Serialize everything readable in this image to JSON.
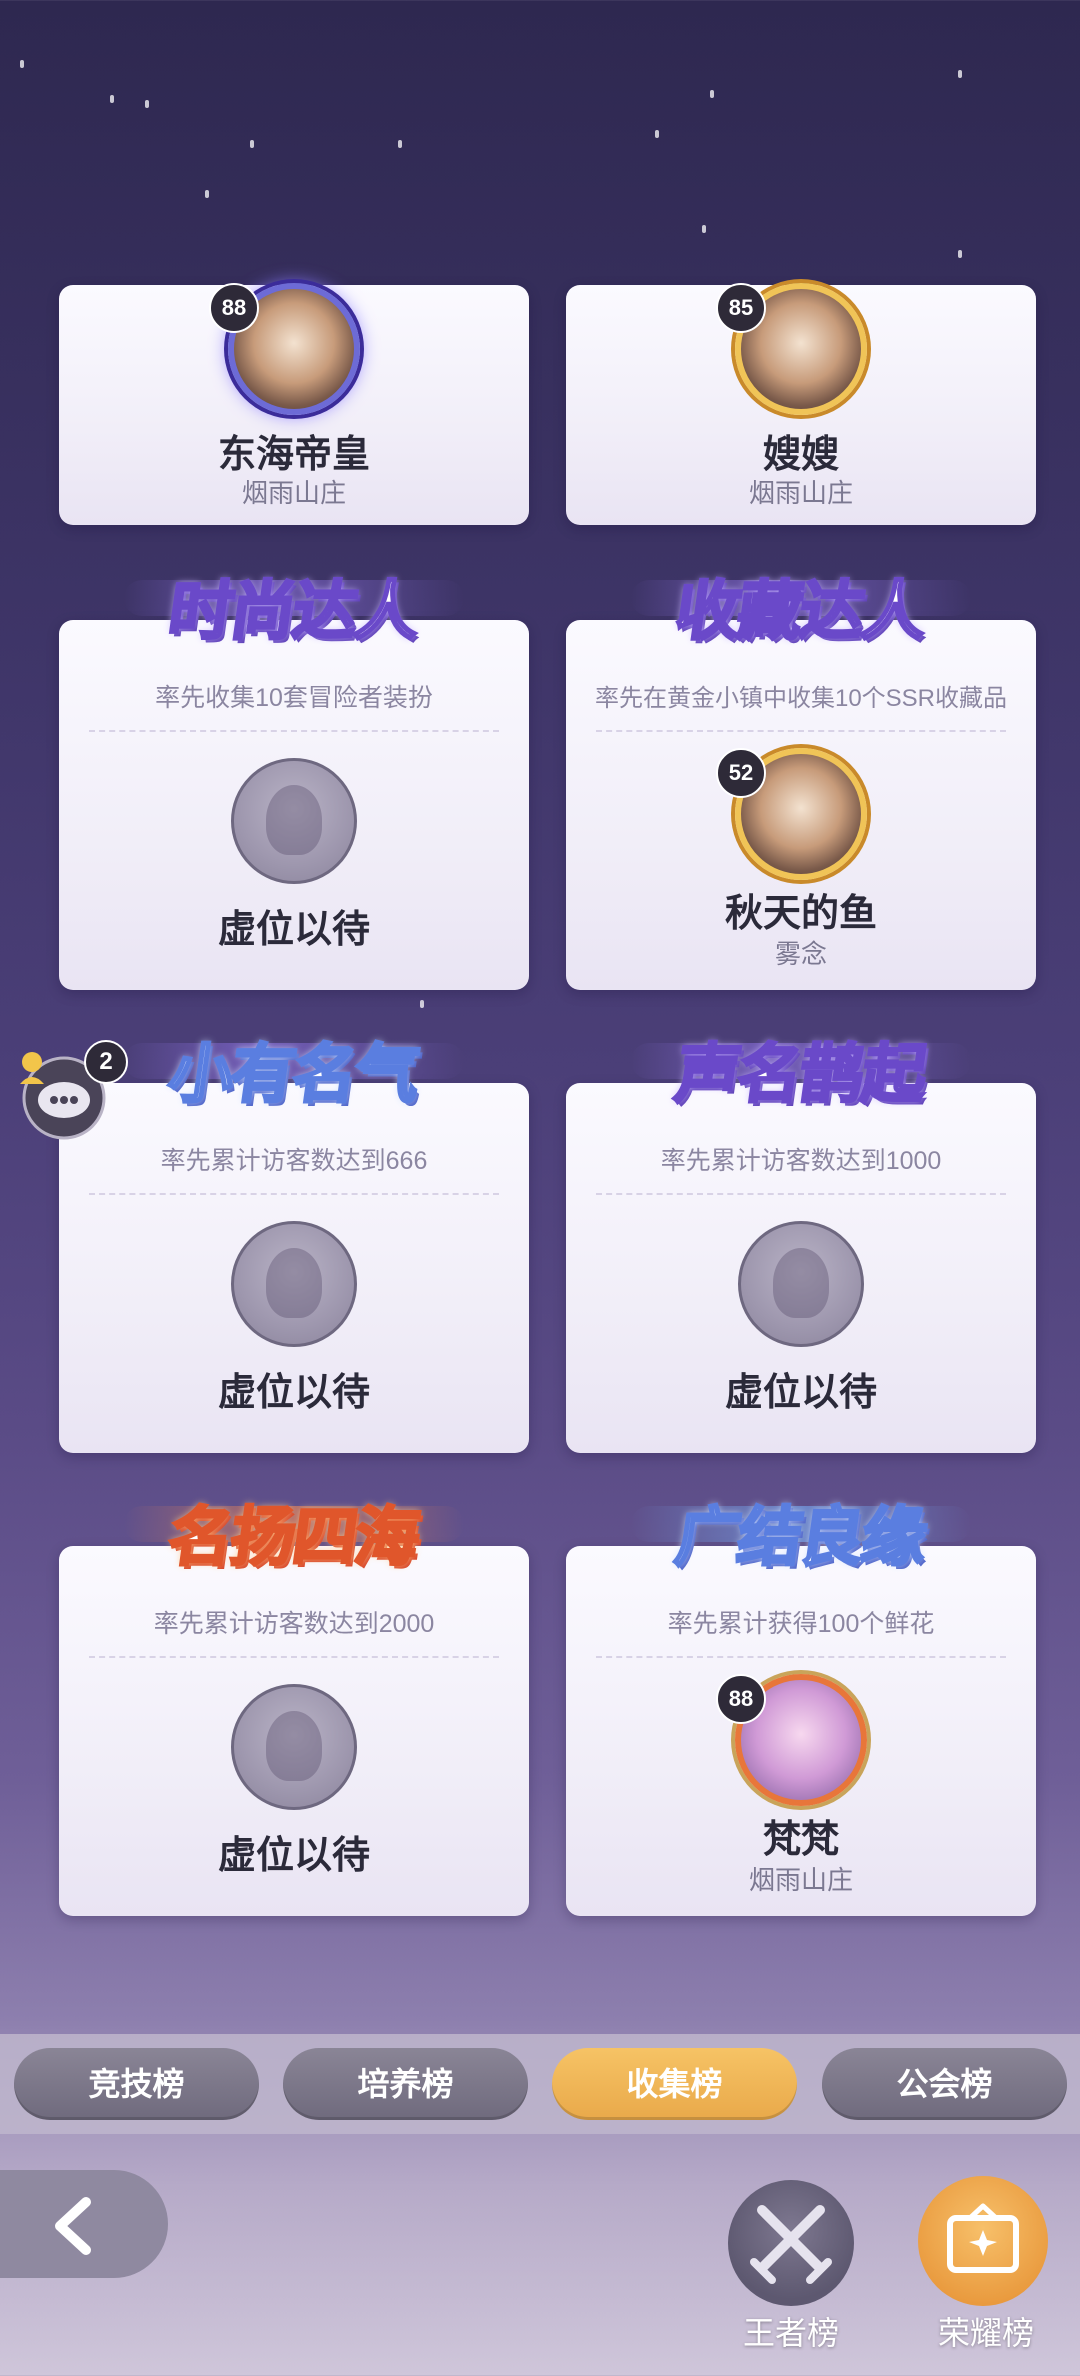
{
  "top_cards": [
    {
      "level": "88",
      "name": "东海帝皇",
      "guild": "烟雨山庄"
    },
    {
      "level": "85",
      "name": "嫂嫂",
      "guild": "烟雨山庄"
    }
  ],
  "achievements": [
    {
      "title": "时尚达人",
      "desc": "率先收集10套冒险者装扮",
      "status": "虚位以待"
    },
    {
      "title": "收藏达人",
      "desc": "率先在黄金小镇中收集10个SSR收藏品",
      "level": "52",
      "name": "秋天的鱼",
      "guild": "雾念"
    },
    {
      "title": "小有名气",
      "desc": "率先累计访客数达到666",
      "status": "虚位以待"
    },
    {
      "title": "声名鹊起",
      "desc": "率先累计访客数达到1000",
      "status": "虚位以待"
    },
    {
      "title": "名扬四海",
      "desc": "率先累计访客数达到2000",
      "status": "虚位以待"
    },
    {
      "title": "广结良缘",
      "desc": "率先累计获得100个鲜花",
      "level": "88",
      "name": "梵梵",
      "guild": "烟雨山庄"
    }
  ],
  "chat": {
    "badge": "2"
  },
  "tabs": [
    {
      "label": "竞技榜"
    },
    {
      "label": "培养榜"
    },
    {
      "label": "收集榜"
    },
    {
      "label": "公会榜"
    }
  ],
  "bottom": {
    "king_label": "王者榜",
    "glory_label": "荣耀榜"
  },
  "colors": {
    "active_tab": "#f0b657",
    "tab": "#7d788b"
  }
}
